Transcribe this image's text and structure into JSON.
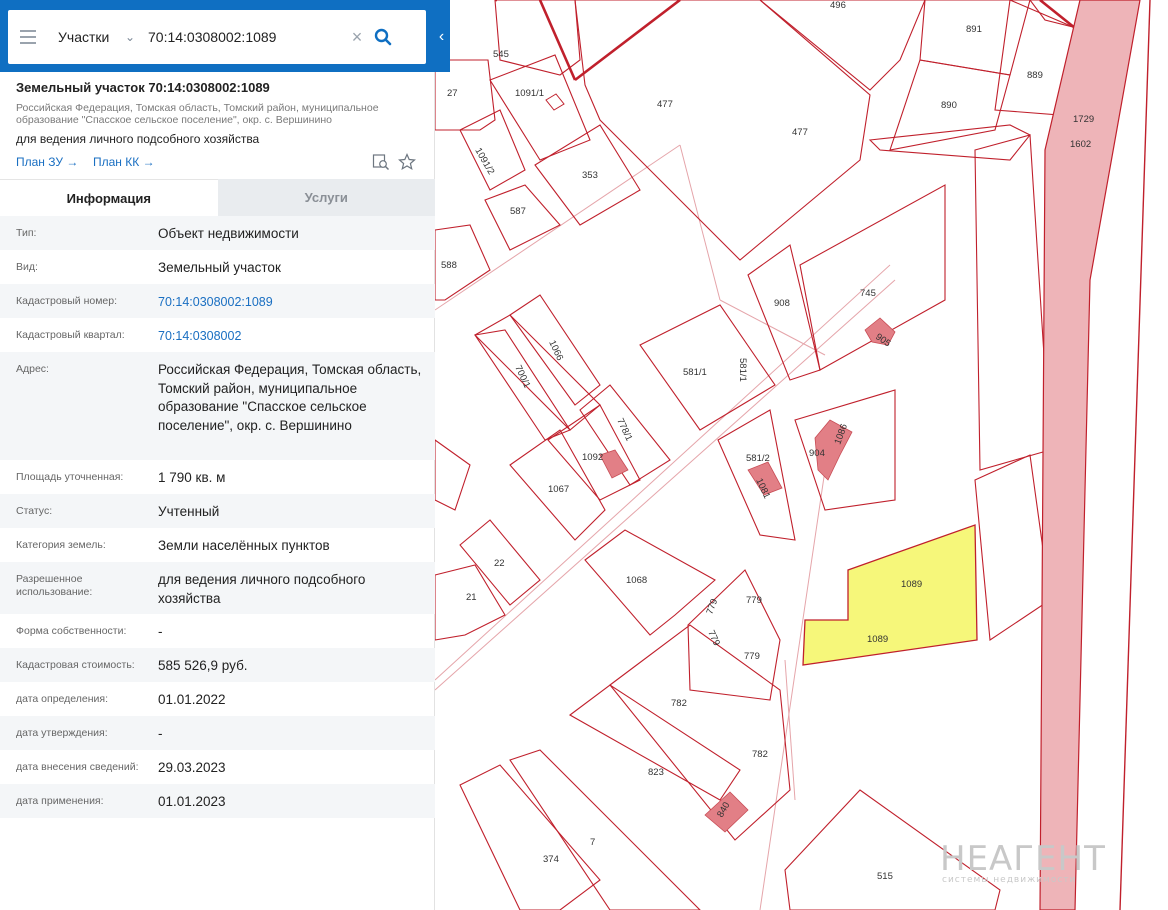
{
  "search": {
    "type_label": "Участки",
    "query": "70:14:0308002:1089"
  },
  "object": {
    "title": "Земельный участок 70:14:0308002:1089",
    "address": "Российская Федерация, Томская область, Томский район, муниципальное образование \"Спасское сельское поселение\", окр. с. Вершинино",
    "purpose": "для ведения личного подсобного хозяйства",
    "links": {
      "plan_zu": "План ЗУ →",
      "plan_kk": "План КК →"
    }
  },
  "tabs": {
    "info": "Информация",
    "services": "Услуги"
  },
  "info": [
    {
      "label": "Тип:",
      "value": "Объект недвижимости"
    },
    {
      "label": "Вид:",
      "value": "Земельный участок"
    },
    {
      "label": "Кадастровый номер:",
      "value": "70:14:0308002:1089"
    },
    {
      "label": "Кадастровый квартал:",
      "value": "70:14:0308002"
    },
    {
      "label": "Адрес:",
      "value": "Российская Федерация, Томская область, Томский район, муниципальное образование \"Спасское сельское поселение\", окр. с. Вершинино"
    },
    {
      "label": "Площадь уточненная:",
      "value": "1 790 кв. м"
    },
    {
      "label": "Статус:",
      "value": "Учтенный"
    },
    {
      "label": "Категория земель:",
      "value": "Земли населённых пунктов"
    },
    {
      "label": "Разрешенное использование:",
      "value": "для ведения личного подсобного хозяйства"
    },
    {
      "label": "Форма собственности:",
      "value": "-"
    },
    {
      "label": "Кадастровая стоимость:",
      "value": "585 526,9 руб."
    },
    {
      "label": "дата определения:",
      "value": "01.01.2022"
    },
    {
      "label": "дата утверждения:",
      "value": "-"
    },
    {
      "label": "дата внесения сведений:",
      "value": "29.03.2023"
    },
    {
      "label": "дата применения:",
      "value": "01.01.2023"
    }
  ],
  "map": {
    "plot_labels": [
      "496",
      "545",
      "27",
      "1091/1",
      "477",
      "477",
      "891",
      "889",
      "890",
      "1729",
      "1602",
      "1091/2",
      "353",
      "587",
      "588",
      "908",
      "745",
      "905",
      "1066",
      "700/1",
      "581/1",
      "581/1",
      "778/1",
      "1092",
      "1067",
      "581/2",
      "1081",
      "904",
      "1086",
      "22",
      "21",
      "1068",
      "779",
      "779",
      "779",
      "779",
      "1089",
      "1089",
      "782",
      "782",
      "823",
      "840",
      "7",
      "374",
      "515"
    ],
    "watermark": {
      "brand": "НЕАГЕНТ",
      "tagline": "системы недвижимости"
    }
  },
  "colors": {
    "header_bg": "#0f6fc2",
    "link": "#1a6fc2",
    "boundary": "#c0202c",
    "road_fill": "#eeb4b8",
    "building": "#e27f86",
    "selected_plot": "#f6f77a"
  }
}
